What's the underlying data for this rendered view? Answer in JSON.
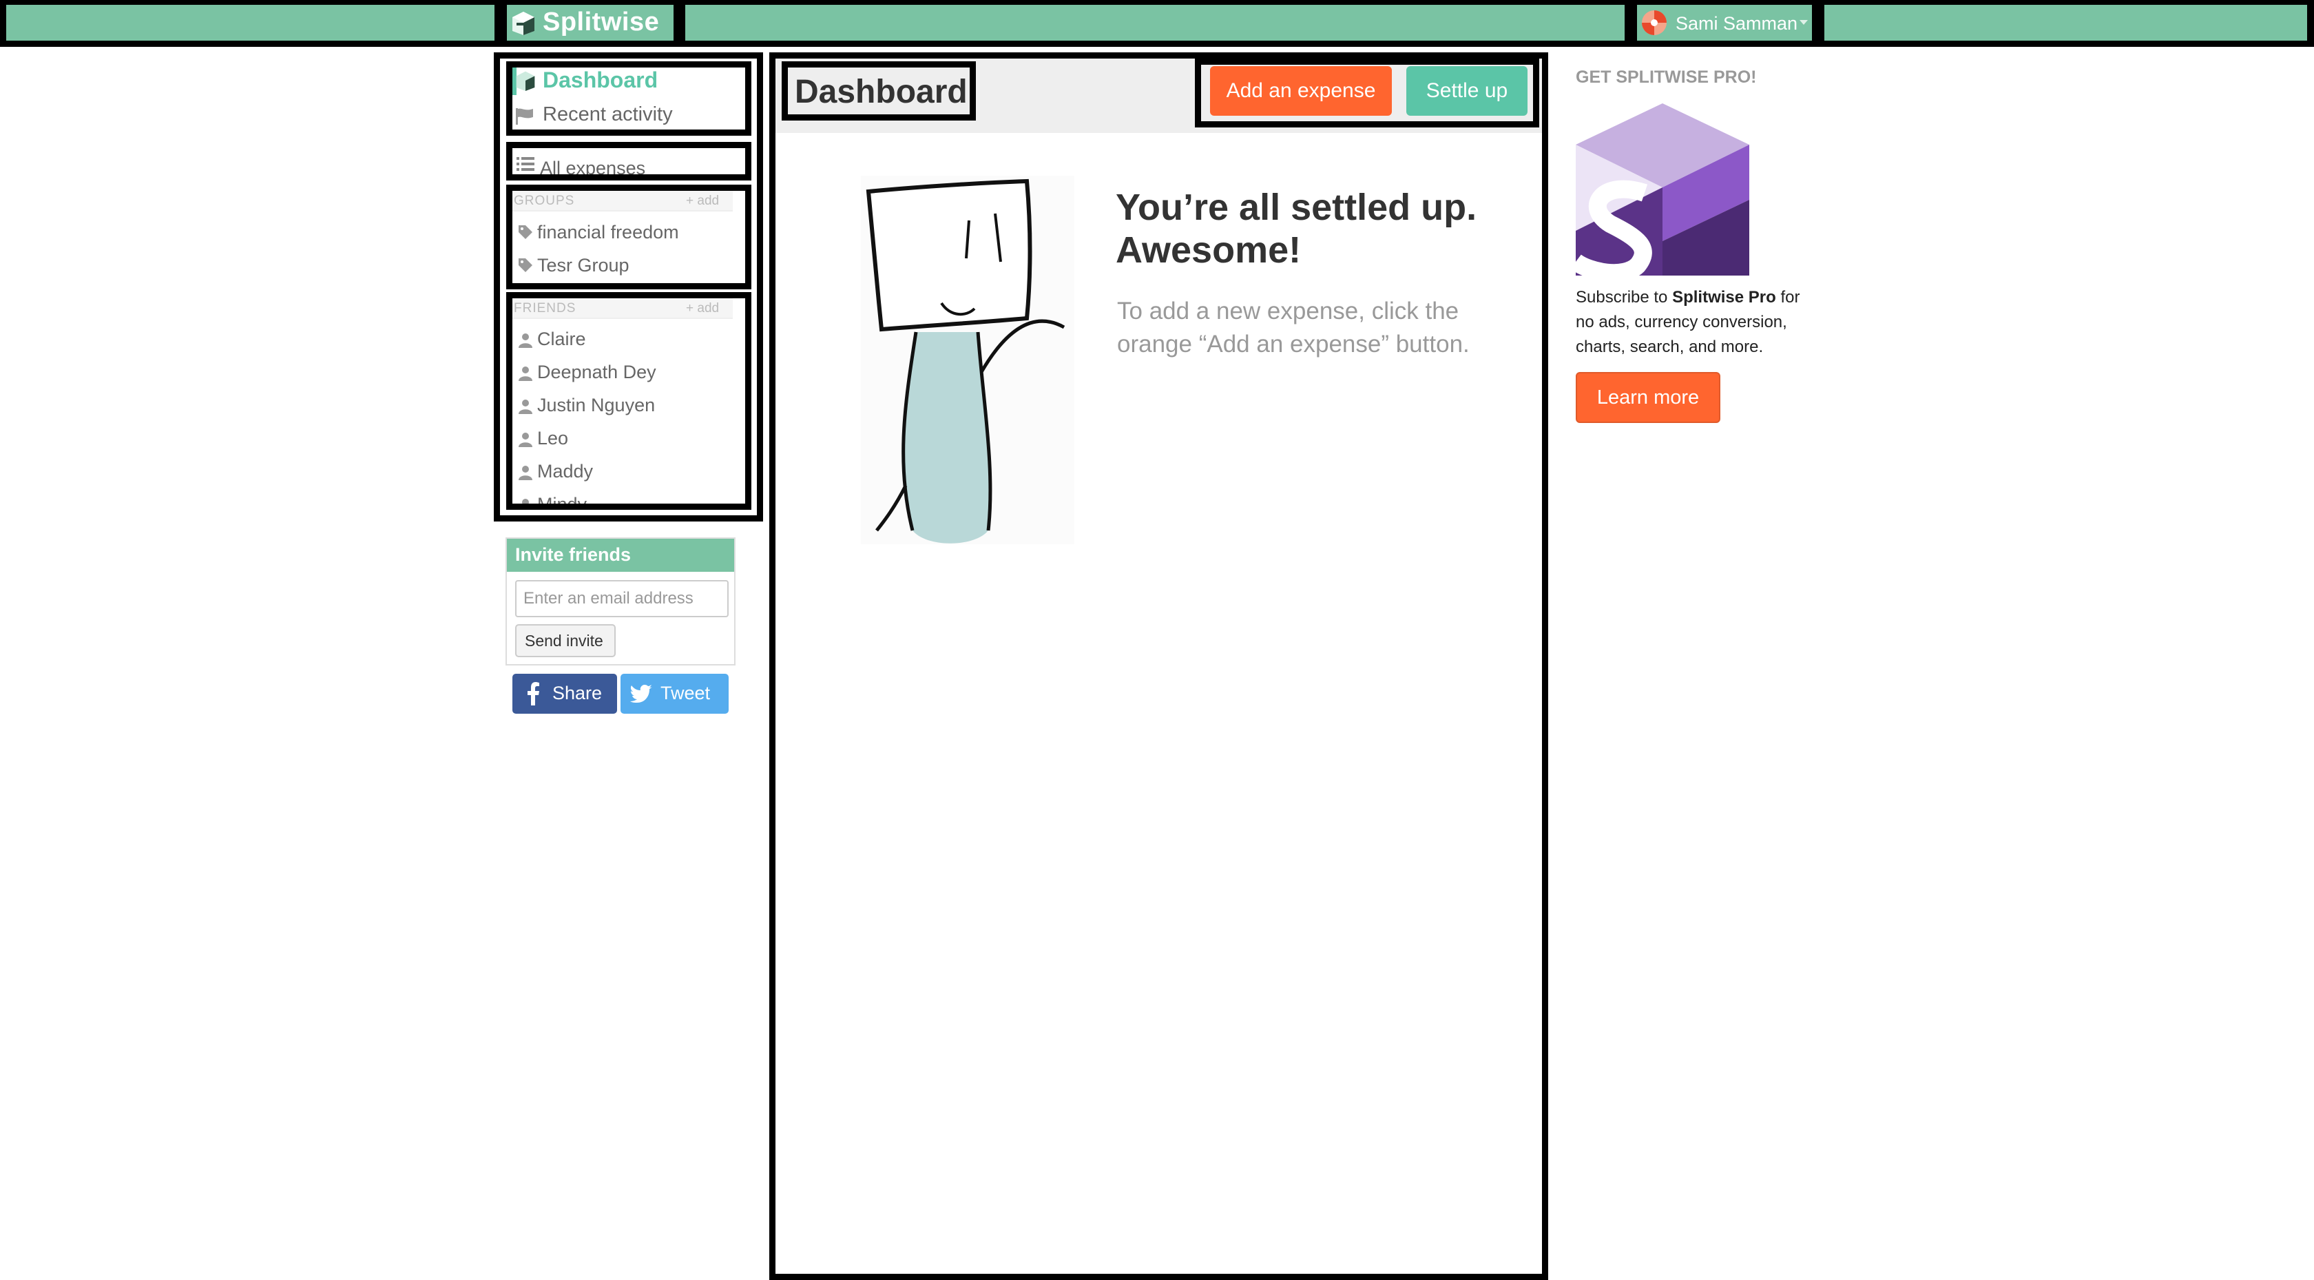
{
  "app": {
    "name": "Splitwise",
    "logo_icon": "splitwise-logo-icon",
    "brand_color": "#7ac3a3"
  },
  "user": {
    "name": "Sami Samman",
    "menu_icon": "caret-down-icon"
  },
  "sidebar": {
    "dashboard": "Dashboard",
    "recent_activity": "Recent activity",
    "all_expenses": "All expenses",
    "groups_header": "GROUPS",
    "groups_add": "+ add",
    "groups": [
      "financial freedom",
      "Tesr Group"
    ],
    "friends_header": "FRIENDS",
    "friends_add": "+ add",
    "friends": [
      "Claire",
      "Deepnath Dey",
      "Justin Nguyen",
      "Leo",
      "Maddy",
      "Mindy"
    ]
  },
  "invite": {
    "title": "Invite friends",
    "email_placeholder": "Enter an email address",
    "send_label": "Send invite",
    "share_label": "Share",
    "tweet_label": "Tweet"
  },
  "main": {
    "title": "Dashboard",
    "add_expense": "Add an expense",
    "settle_up": "Settle up",
    "settled_title_line1": "You’re all settled up.",
    "settled_title_line2": "Awesome!",
    "settled_hint_line1": "To add a new expense, click the",
    "settled_hint_line2": "orange “Add an expense” button."
  },
  "promo": {
    "heading": "GET SPLITWISE PRO!",
    "line1_prefix": "Subscribe to ",
    "line1_bold": "Splitwise Pro",
    "line1_suffix": " for",
    "line2": "no ads, currency conversion,",
    "line3": "charts, search, and more.",
    "learn_more": "Learn more"
  }
}
